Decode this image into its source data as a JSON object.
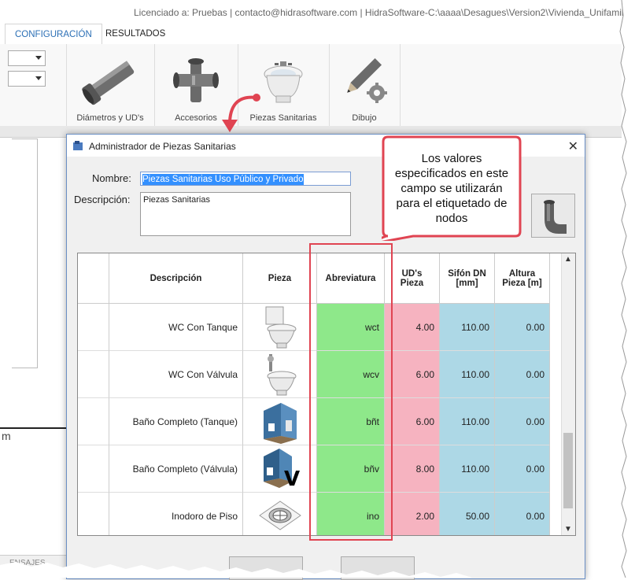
{
  "window": {
    "title": "Licenciado a: Pruebas | contacto@hidrasoftware.com | HidraSoftware-C:\\aaaa\\Desagues\\Version2\\Vivienda_Unifamiliar.di"
  },
  "tabs": [
    {
      "label": "CONFIGURACIÓN",
      "active": true
    },
    {
      "label": "RESULTADOS",
      "active": false
    }
  ],
  "ribbon": {
    "buttons": [
      {
        "label": "Diámetros y UD's",
        "icon": "pipe-icon"
      },
      {
        "label": "Accesorios",
        "icon": "fitting-cross-icon"
      },
      {
        "label": "Piezas Sanitarias",
        "icon": "bidet-icon"
      },
      {
        "label": "Dibujo",
        "icon": "pencil-gear-icon"
      }
    ]
  },
  "left_pane": {
    "char": "m",
    "bottom_tab": "ENSAJES"
  },
  "dialog": {
    "title": "Administrador de Piezas Sanitarias",
    "close": "✕",
    "name_label": "Nombre:",
    "name_value": "Piezas Sanitarias Uso Público y Privado",
    "desc_label": "Descripción:",
    "desc_value": "Piezas Sanitarias",
    "grid": {
      "headers": [
        "Descripción",
        "Pieza",
        "Abreviatura",
        "UD's\nPieza",
        "Sifón DN\n[mm]",
        "Altura\nPieza [m]"
      ],
      "rows": [
        {
          "descripcion": "WC Con Tanque",
          "icon": "toilet-tank-icon",
          "abreviatura": "wct",
          "ud": "4.00",
          "sifon": "110.00",
          "altura": "0.00"
        },
        {
          "descripcion": "WC Con Válvula",
          "icon": "toilet-valve-icon",
          "abreviatura": "wcv",
          "ud": "6.00",
          "sifon": "110.00",
          "altura": "0.00"
        },
        {
          "descripcion": "Baño Completo (Tanque)",
          "icon": "bathroom-tank-icon",
          "abreviatura": "bñt",
          "ud": "6.00",
          "sifon": "110.00",
          "altura": "0.00"
        },
        {
          "descripcion": "Baño Completo (Válvula)",
          "icon": "bathroom-valve-icon",
          "icon_text": "V",
          "abreviatura": "bñv",
          "ud": "8.00",
          "sifon": "110.00",
          "altura": "0.00"
        },
        {
          "descripcion": "Inodoro de Piso",
          "icon": "floor-drain-icon",
          "abreviatura": "ino",
          "ud": "2.00",
          "sifon": "50.00",
          "altura": "0.00"
        }
      ]
    }
  },
  "annotation": {
    "callout_text": "Los valores especificados en este campo se utilizarán para el etiquetado de nodos"
  },
  "colors": {
    "accent": "#2b6fb5",
    "abbrev_fill": "#8ee88a",
    "ud_fill": "#f6b3c0",
    "sifon_fill": "#add8e6",
    "altura_fill": "#add8e6",
    "annotation_red": "#e04452"
  }
}
